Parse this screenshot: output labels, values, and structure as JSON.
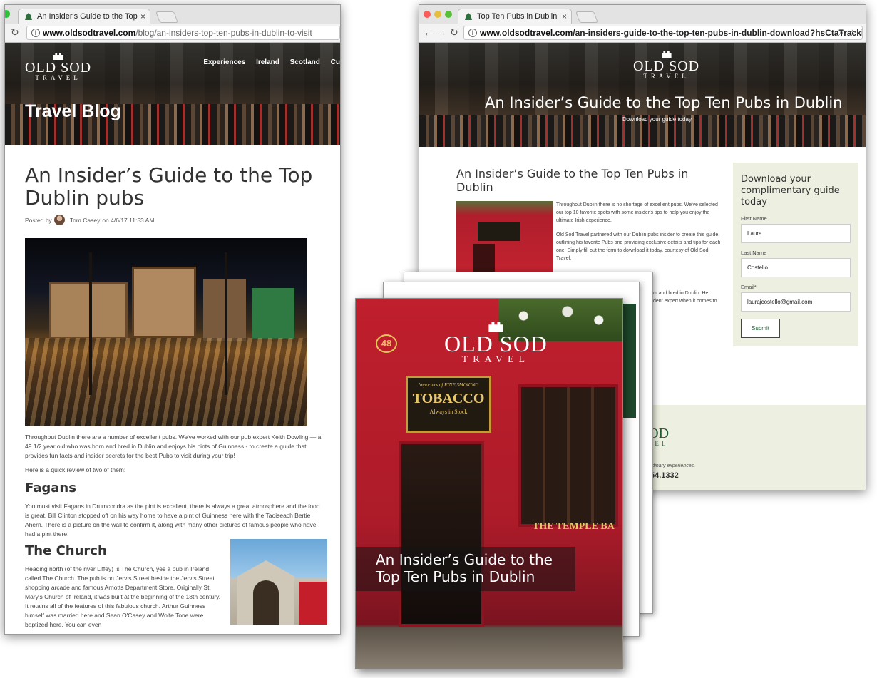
{
  "left_window": {
    "tab_title": "An Insider's Guide to the Top",
    "tab_close": "×",
    "url_domain": "www.oldsodtravel.com",
    "url_path": "/blog/an-insiders-top-ten-pubs-in-dublin-to-visit",
    "logo_line1": "OLD SOD",
    "logo_line2": "TRAVEL",
    "nav": [
      "Experiences",
      "Ireland",
      "Scotland",
      "Cu"
    ],
    "hero_title": "Travel Blog",
    "article_title": "An Insider’s Guide to the Top Dublin pubs",
    "posted_by": "Posted by",
    "author": "Tom Casey",
    "posted_on": "on 4/6/17 11:53 AM",
    "intro": "Throughout Dublin there are a number of excellent pubs. We've worked with our pub expert Keith Dowling — a 49 1/2 year old who was born and bred in Dublin and enjoys his pints of Guinness - to create a guide that provides fun facts and insider secrets for the best Pubs to visit during your trip!",
    "quick_review": "Here is a quick review of two of them:",
    "h_fagans": "Fagans",
    "fagans_text": "You must visit Fagans in Drumcondra as the pint is excellent, there is always a great atmosphere and the food is great. Bill Clinton stopped off on his way home to have a pint of Guinness here with the Taoiseach Bertie Ahern. There is a picture on the wall to confirm it, along with many other pictures of famous people who have had a pint there.",
    "h_church": "The Church",
    "church_text": "Heading north (of the river Liffey) is The Church, yes a pub in Ireland called The Church. The pub is on Jervis Street beside the Jervis Street shopping arcade and famous Arnotts Department Store. Originally St. Mary's Church of Ireland, it was built at the beginning of the 18th century. It retains all of the features of this fabulous church. Arthur Guinness himself was married here and Sean O'Casey and Wolfe Tone were baptized here. You can even"
  },
  "right_window": {
    "tab_title": "Top Ten Pubs in Dublin",
    "tab_close": "×",
    "url_domain": "www.oldsodtravel.com",
    "url_path": "/an-insiders-guide-to-the-top-ten-pubs-in-dublin-download?hsCtaTracking=2b...",
    "logo_line1": "OLD SOD",
    "logo_line2": "TRAVEL",
    "hero_title": "An Insider’s Guide to the Top Ten Pubs in Dublin",
    "hero_sub": "Download your guide today",
    "content_title": "An Insider’s Guide to the Top Ten Pubs in Dublin",
    "para1": "Throughout Dublin there is no shortage of excellent pubs. We've selected our top 10 favorite spots with some insider's tips to help you enjoy the ultimate Irish experience.",
    "para2": "Old Sod Travel partnered with our Dublin pubs insider to create this guide, outlining his favorite Pubs and providing exclusive details and tips for each one. Simply fill out the form to download it today, courtesy of Old Sod Travel.",
    "para3_frag": "m and bred in Dublin. He",
    "para4_frag": "dent expert when it comes to",
    "form_title": "Download your complimentary guide today",
    "first_name_label": "First Name",
    "first_name_value": "Laura",
    "last_name_label": "Last Name",
    "last_name_value": "Costello",
    "email_label": "Email*",
    "email_value": "laurajcostello@gmail.com",
    "submit": "Submit",
    "footer_logo": "SOD",
    "footer_logo2": "AVEL",
    "footer_tag": "rdinary experiences.",
    "footer_phone": "54.1332"
  },
  "guide_cover": {
    "logo_line1": "OLD SOD",
    "logo_line2": "TRAVEL",
    "sign_small": "Importers of FINE SMOKING",
    "sign_big": "TOBACCO",
    "sign_sub": "Always in Stock",
    "door_number": "48",
    "temple_bar": "THE TEMPLE BA",
    "title": "An Insider’s Guide to the Top Ten Pubs in Dublin"
  },
  "colors": {
    "brand_green": "#1f5c34",
    "form_bg": "#edf0e0",
    "pub_red": "#b01e2c"
  }
}
